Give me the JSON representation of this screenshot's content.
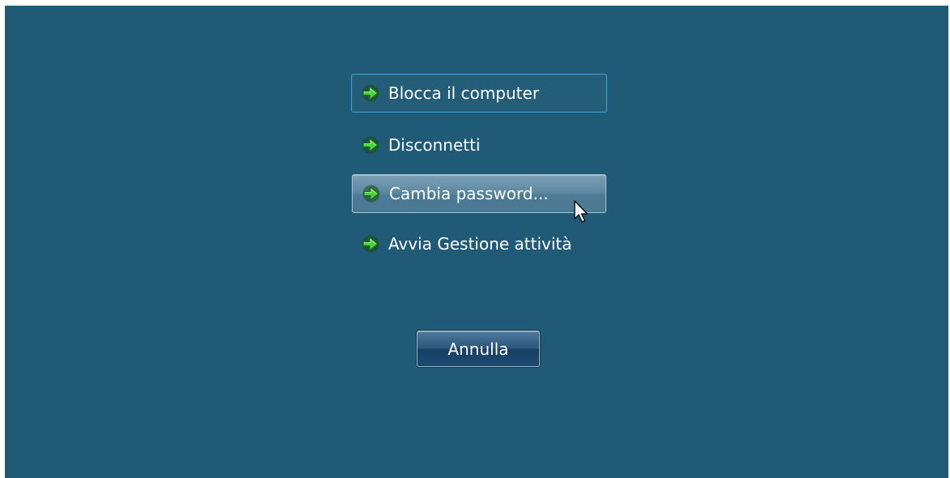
{
  "options": [
    {
      "label": "Blocca il computer",
      "icon": "arrow-right-icon",
      "state": "focused"
    },
    {
      "label": "Disconnetti",
      "icon": "arrow-right-icon",
      "state": "normal"
    },
    {
      "label": "Cambia password...",
      "icon": "arrow-right-icon",
      "state": "hover"
    },
    {
      "label": "Avvia Gestione attività",
      "icon": "arrow-right-icon",
      "state": "normal"
    }
  ],
  "cancel_button": {
    "label": "Annulla"
  },
  "colors": {
    "background": "#1f5a76",
    "arrow_green": "#3fcf3a",
    "focus_border": "#3c9ccf"
  }
}
